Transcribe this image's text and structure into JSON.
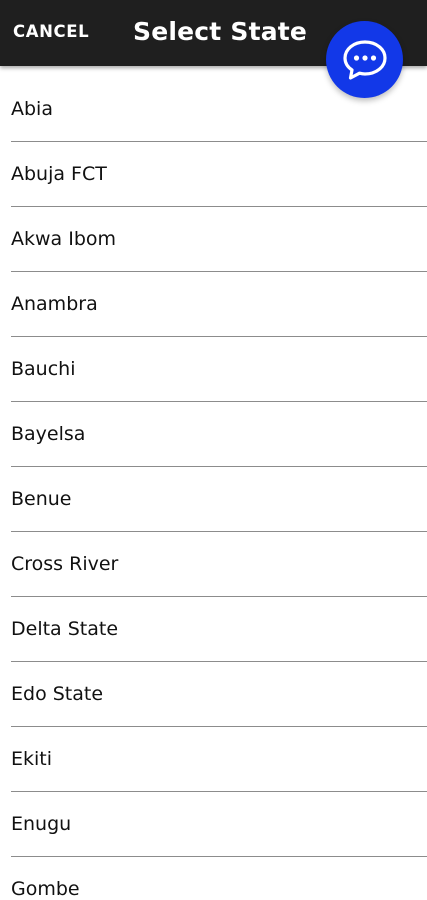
{
  "header": {
    "cancel_label": "CANCEL",
    "title": "Select State"
  },
  "fab": {
    "icon": "chat-bubble-icon",
    "color": "#1238e8"
  },
  "states": [
    {
      "label": "Abia"
    },
    {
      "label": "Abuja FCT"
    },
    {
      "label": "Akwa Ibom"
    },
    {
      "label": "Anambra"
    },
    {
      "label": "Bauchi"
    },
    {
      "label": "Bayelsa"
    },
    {
      "label": "Benue"
    },
    {
      "label": "Cross River"
    },
    {
      "label": "Delta State"
    },
    {
      "label": "Edo State"
    },
    {
      "label": "Ekiti"
    },
    {
      "label": "Enugu"
    },
    {
      "label": "Gombe"
    }
  ]
}
